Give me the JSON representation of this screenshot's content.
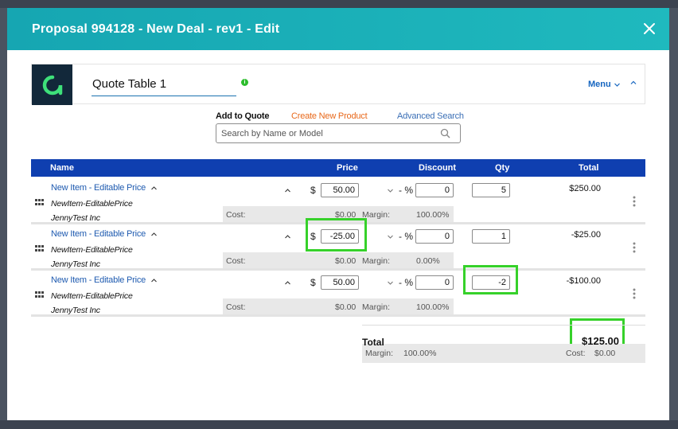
{
  "modal": {
    "title": "Proposal 994128 - New Deal - rev1 - Edit"
  },
  "quote": {
    "title": "Quote Table 1",
    "info_badge": "i",
    "menu_label": "Menu"
  },
  "add_bar": {
    "add_to_quote": "Add to Quote",
    "create_product": "Create New Product",
    "advanced_search": "Advanced Search",
    "search_placeholder": "Search by Name or Model"
  },
  "table": {
    "columns": {
      "name": "Name",
      "price": "Price",
      "discount": "Discount",
      "qty": "Qty",
      "total": "Total"
    },
    "currency_symbol": "$",
    "percent_symbol": "- %",
    "cost_label": "Cost:",
    "margin_label": "Margin:",
    "rows": [
      {
        "name": "New Item - Editable Price",
        "model": "NewItem-EditablePrice",
        "vendor": "JennyTest Inc",
        "price": "50.00",
        "discount": "0",
        "qty": "5",
        "total": "$250.00",
        "cost": "$0.00",
        "margin": "100.00%"
      },
      {
        "name": "New Item - Editable Price",
        "model": "NewItem-EditablePrice",
        "vendor": "JennyTest Inc",
        "price": "-25.00",
        "discount": "0",
        "qty": "1",
        "total": "-$25.00",
        "cost": "$0.00",
        "margin": "0.00%"
      },
      {
        "name": "New Item - Editable Price",
        "model": "NewItem-EditablePrice",
        "vendor": "JennyTest Inc",
        "price": "50.00",
        "discount": "0",
        "qty": "-2",
        "total": "-$100.00",
        "cost": "$0.00",
        "margin": "100.00%"
      }
    ]
  },
  "totals": {
    "label": "Total",
    "value": "$125.00",
    "margin_label": "Margin:",
    "margin_value": "100.00%",
    "cost_label": "Cost:",
    "cost_value": "$0.00"
  },
  "colors": {
    "header_teal": "#1fb9be",
    "table_head_blue": "#0f3fb0",
    "highlight_green": "#36d12a",
    "link_orange": "#e8681a",
    "link_blue": "#3b6fb6"
  }
}
